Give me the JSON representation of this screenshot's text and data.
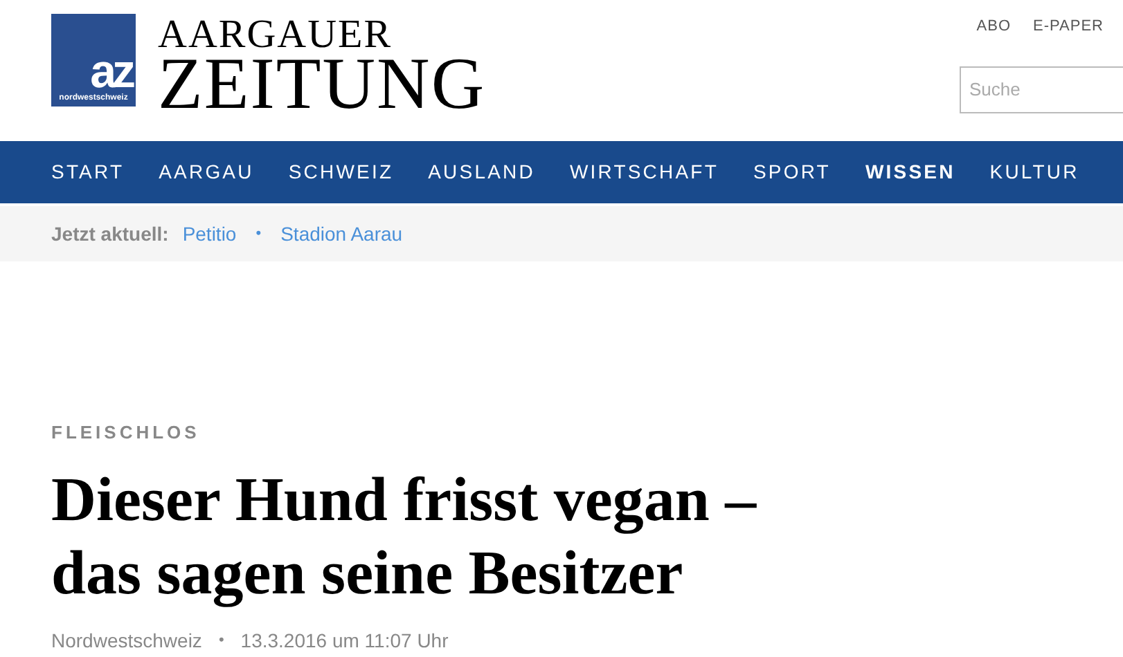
{
  "logo": {
    "mark": "az",
    "tagline": "nordwestschweiz",
    "title_top": "AARGAUER",
    "title_bottom": "ZEITUNG"
  },
  "top_links": [
    "ABO",
    "E-PAPER"
  ],
  "search": {
    "placeholder": "Suche"
  },
  "nav": [
    {
      "label": "START",
      "selected": false
    },
    {
      "label": "AARGAU",
      "selected": false
    },
    {
      "label": "SCHWEIZ",
      "selected": false
    },
    {
      "label": "AUSLAND",
      "selected": false
    },
    {
      "label": "WIRTSCHAFT",
      "selected": false
    },
    {
      "label": "SPORT",
      "selected": false
    },
    {
      "label": "WISSEN",
      "selected": true
    },
    {
      "label": "KULTUR",
      "selected": false
    }
  ],
  "trending": {
    "label": "Jetzt aktuell:",
    "links": [
      "Petitio",
      "Stadion Aarau"
    ],
    "separator": "•"
  },
  "article": {
    "category": "FLEISCHLOS",
    "headline": "Dieser Hund frisst vegan – das sagen seine Besitzer",
    "source": "Nordwestschweiz",
    "separator": "•",
    "date": "13.3.2016 um 11:07 Uhr"
  }
}
